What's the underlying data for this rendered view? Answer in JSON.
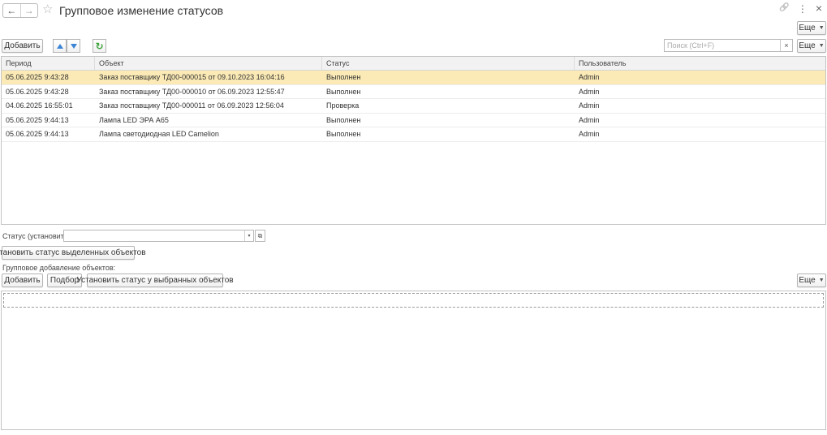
{
  "window": {
    "title": "Групповое изменение статусов",
    "nav_back": "←",
    "nav_forward": "→",
    "star": "☆",
    "link_icon": "🔗",
    "menu_icon": "⋮",
    "close_icon": "×"
  },
  "toolbar": {
    "more_top": "Еще",
    "add": "Добавить",
    "more": "Еще",
    "search_placeholder": "Поиск (Ctrl+F)",
    "search_clear": "×",
    "refresh": "↻"
  },
  "table": {
    "columns": [
      "Период",
      "Объект",
      "Статус",
      "Пользователь"
    ],
    "rows": [
      {
        "period": "05.06.2025 9:43:28",
        "object": "Заказ поставщику ТД00-000015 от 09.10.2023 16:04:16",
        "status": "Выполнен",
        "user": "Admin"
      },
      {
        "period": "05.06.2025 9:43:28",
        "object": "Заказ поставщику ТД00-000010 от 06.09.2023 12:55:47",
        "status": "Выполнен",
        "user": "Admin"
      },
      {
        "period": "04.06.2025 16:55:01",
        "object": "Заказ поставщику ТД00-000011 от 06.09.2023 12:56:04",
        "status": "Проверка",
        "user": "Admin"
      },
      {
        "period": "05.06.2025 9:44:13",
        "object": "Лампа LED ЭРА А65",
        "status": "Выполнен",
        "user": "Admin"
      },
      {
        "period": "05.06.2025 9:44:13",
        "object": "Лампа светодиодная LED Camelion",
        "status": "Выполнен",
        "user": "Admin"
      }
    ]
  },
  "status_form": {
    "label": "Статус (установить):",
    "value": "",
    "dropdown_glyph": "▾",
    "open_glyph": "⧉",
    "set_selected_button": "Установить статус выделенных объектов"
  },
  "group_add": {
    "label": "Групповое добавление объектов:",
    "add": "Добавить",
    "pick": "Подбор",
    "set_status": "Установить статус у выбранных объектов",
    "more": "Еще"
  },
  "colors": {
    "selected_row": "#fbeab5",
    "arrow_blue": "#3a84d6",
    "refresh_green": "#3aa23a"
  }
}
